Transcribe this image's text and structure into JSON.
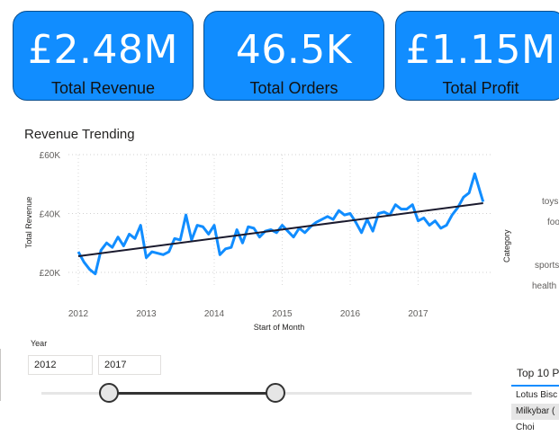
{
  "kpis": {
    "revenue": {
      "value": "£2.48M",
      "label": "Total Revenue"
    },
    "orders": {
      "value": "46.5K",
      "label": "Total Orders"
    },
    "profit": {
      "value": "£1.15M",
      "label": "Total Profit"
    }
  },
  "revenue_chart": {
    "title": "Revenue Trending"
  },
  "chart_data": {
    "type": "line",
    "title": "Revenue Trending",
    "xlabel": "Start of Month",
    "ylabel": "Total Revenue",
    "x_ticks": [
      "2012",
      "2013",
      "2014",
      "2015",
      "2016",
      "2017"
    ],
    "y_ticks": [
      "£20K",
      "£40K",
      "£60K"
    ],
    "ylim": [
      20000,
      60000
    ],
    "grid": true,
    "x": [
      "2012-01",
      "2012-02",
      "2012-03",
      "2012-04",
      "2012-05",
      "2012-06",
      "2012-07",
      "2012-08",
      "2012-09",
      "2012-10",
      "2012-11",
      "2012-12",
      "2013-01",
      "2013-02",
      "2013-03",
      "2013-04",
      "2013-05",
      "2013-06",
      "2013-07",
      "2013-08",
      "2013-09",
      "2013-10",
      "2013-11",
      "2013-12",
      "2014-01",
      "2014-02",
      "2014-03",
      "2014-04",
      "2014-05",
      "2014-06",
      "2014-07",
      "2014-08",
      "2014-09",
      "2014-10",
      "2014-11",
      "2014-12",
      "2015-01",
      "2015-02",
      "2015-03",
      "2015-04",
      "2015-05",
      "2015-06",
      "2015-07",
      "2015-08",
      "2015-09",
      "2015-10",
      "2015-11",
      "2015-12",
      "2016-01",
      "2016-02",
      "2016-03",
      "2016-04",
      "2016-05",
      "2016-06",
      "2016-07",
      "2016-08",
      "2016-09",
      "2016-10",
      "2016-11",
      "2016-12",
      "2017-01",
      "2017-02",
      "2017-03",
      "2017-04",
      "2017-05",
      "2017-06",
      "2017-07",
      "2017-08",
      "2017-09",
      "2017-10",
      "2017-11",
      "2017-12"
    ],
    "series": [
      {
        "values": [
          27000,
          23500,
          21000,
          19500,
          27500,
          30000,
          28500,
          32000,
          29000,
          33000,
          31500,
          36000,
          25000,
          27000,
          26500,
          26000,
          27000,
          31500,
          31000,
          39500,
          31000,
          36000,
          35500,
          33000,
          36000,
          26000,
          28000,
          28500,
          34500,
          30000,
          35500,
          35000,
          32000,
          34000,
          34500,
          33500,
          36000,
          34000,
          32000,
          35000,
          33500,
          35500,
          37000,
          38000,
          39000,
          38000,
          41000,
          39500,
          40000,
          37000,
          33500,
          38000,
          34000,
          40000,
          40500,
          39500,
          43000,
          41500,
          41500,
          43000,
          37500,
          38500,
          36000,
          37500,
          35000,
          36000,
          39500,
          42000,
          45500,
          47000,
          53500,
          47000
        ],
        "last_point": 44000
      }
    ],
    "trendline": {
      "start": 25500,
      "end": 43500
    }
  },
  "category_chart": {
    "ylabel": "Category",
    "items": [
      "toys",
      "foo",
      "sports",
      "health"
    ]
  },
  "year_slicer": {
    "title": "Year",
    "start": "2012",
    "end": "2017"
  },
  "top10": {
    "title": "Top 10 P",
    "rows": [
      "Lotus Bisc",
      "Milkybar (",
      "Choi"
    ]
  },
  "colors": {
    "accent": "#118DFF",
    "trendline": "#1a1a2e",
    "kpi_border": "#0a4f8f"
  }
}
